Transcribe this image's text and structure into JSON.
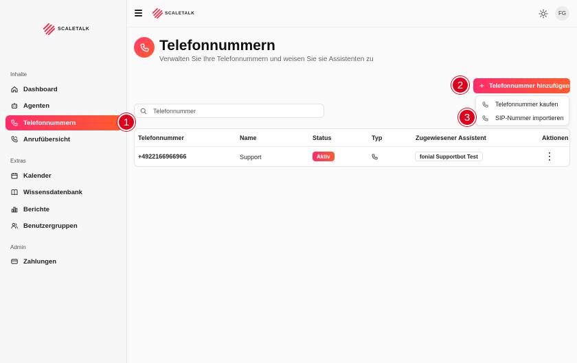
{
  "brand": {
    "name": "SCALETALK",
    "accent": "#ff2d6b",
    "accent_end": "#ff5b2e",
    "callout_color": "#e0001b"
  },
  "sidebar": {
    "sections": [
      {
        "label": "Inhalte"
      },
      {
        "label": "Extras"
      },
      {
        "label": "Admin"
      }
    ],
    "items": [
      {
        "label": "Dashboard",
        "icon": "home-icon"
      },
      {
        "label": "Agenten",
        "icon": "bot-icon"
      },
      {
        "label": "Telefonnummern",
        "icon": "phone-icon",
        "active": true
      },
      {
        "label": "Anrufübersicht",
        "icon": "phone-call-icon"
      },
      {
        "label": "Kalender",
        "icon": "calendar-icon"
      },
      {
        "label": "Wissensdatenbank",
        "icon": "book-icon"
      },
      {
        "label": "Berichte",
        "icon": "bar-chart-icon"
      },
      {
        "label": "Benutzergruppen",
        "icon": "users-icon"
      },
      {
        "label": "Zahlungen",
        "icon": "credit-card-icon"
      }
    ]
  },
  "topbar": {
    "avatar_initials": "FG"
  },
  "page": {
    "title": "Telefonnummern",
    "subtitle": "Verwalten Sie Ihre Telefonnummern und weisen Sie sie Assistenten zu"
  },
  "add_button": {
    "label": "Telefonnummer hinzufügen"
  },
  "dropdown": {
    "items": [
      {
        "label": "Telefonnummer kaufen"
      },
      {
        "label": "SIP-Nummer importieren"
      }
    ]
  },
  "search": {
    "placeholder": "Telefonnummer",
    "value": ""
  },
  "table": {
    "columns": [
      "Telefonnummer",
      "Name",
      "Status",
      "Typ",
      "Zugewiesener Assistent",
      "Aktionen"
    ],
    "rows": [
      {
        "number": "+4922166966966",
        "name": "Support",
        "status": "Aktiv",
        "type_icon": "phone-icon",
        "assistant": "fonial Supportbot Test"
      }
    ]
  },
  "callouts": [
    "1",
    "2",
    "3"
  ]
}
